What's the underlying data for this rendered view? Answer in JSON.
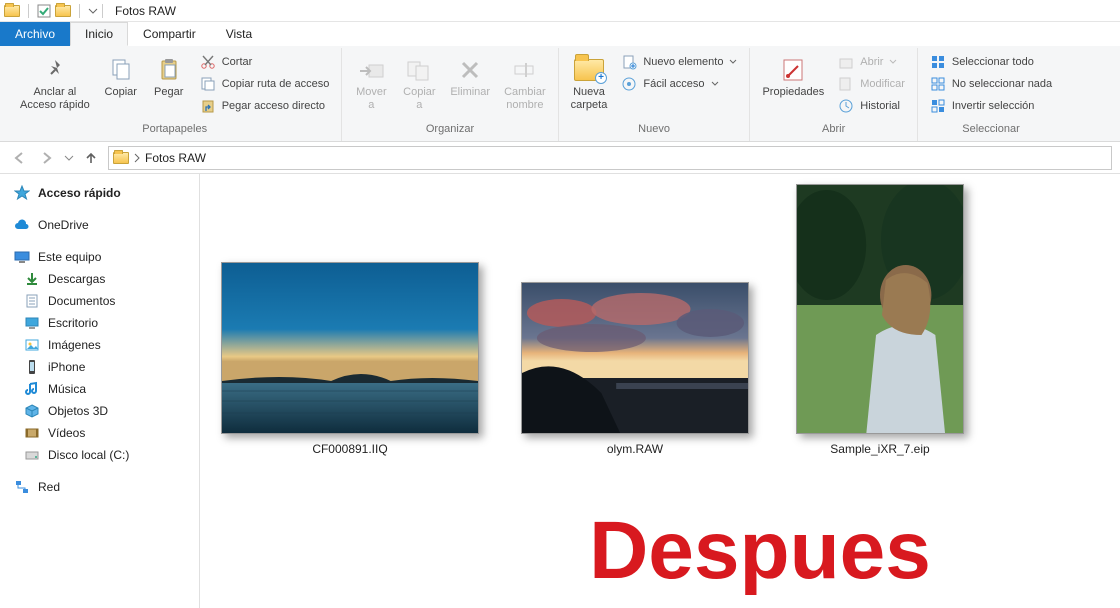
{
  "window": {
    "title": "Fotos RAW"
  },
  "tabs": {
    "file": "Archivo",
    "home": "Inicio",
    "share": "Compartir",
    "view": "Vista"
  },
  "ribbon": {
    "clipboard": {
      "pin": "Anclar al\nAcceso rápido",
      "copy": "Copiar",
      "paste": "Pegar",
      "cut": "Cortar",
      "copy_path": "Copiar ruta de acceso",
      "paste_shortcut": "Pegar acceso directo",
      "group": "Portapapeles"
    },
    "organize": {
      "move_to": "Mover\na",
      "copy_to": "Copiar\na",
      "delete": "Eliminar",
      "rename": "Cambiar\nnombre",
      "group": "Organizar"
    },
    "new_": {
      "new_folder": "Nueva\ncarpeta",
      "new_item": "Nuevo elemento",
      "easy_access": "Fácil acceso",
      "group": "Nuevo"
    },
    "open": {
      "properties": "Propiedades",
      "open": "Abrir",
      "edit": "Modificar",
      "history": "Historial",
      "group": "Abrir"
    },
    "select": {
      "select_all": "Seleccionar todo",
      "select_none": "No seleccionar nada",
      "invert": "Invertir selección",
      "group": "Seleccionar"
    }
  },
  "breadcrumb": {
    "current": "Fotos RAW"
  },
  "tree": {
    "quickaccess": "Acceso rápido",
    "onedrive": "OneDrive",
    "thispc": "Este equipo",
    "downloads": "Descargas",
    "documents": "Documentos",
    "desktop": "Escritorio",
    "pictures": "Imágenes",
    "iphone": "iPhone",
    "music": "Música",
    "objects3d": "Objetos 3D",
    "videos": "Vídeos",
    "localdisk": "Disco local (C:)",
    "network": "Red"
  },
  "files": [
    {
      "name": "CF000891.IIQ"
    },
    {
      "name": "olym.RAW"
    },
    {
      "name": "Sample_iXR_7.eip"
    }
  ],
  "overlay": "Despues"
}
